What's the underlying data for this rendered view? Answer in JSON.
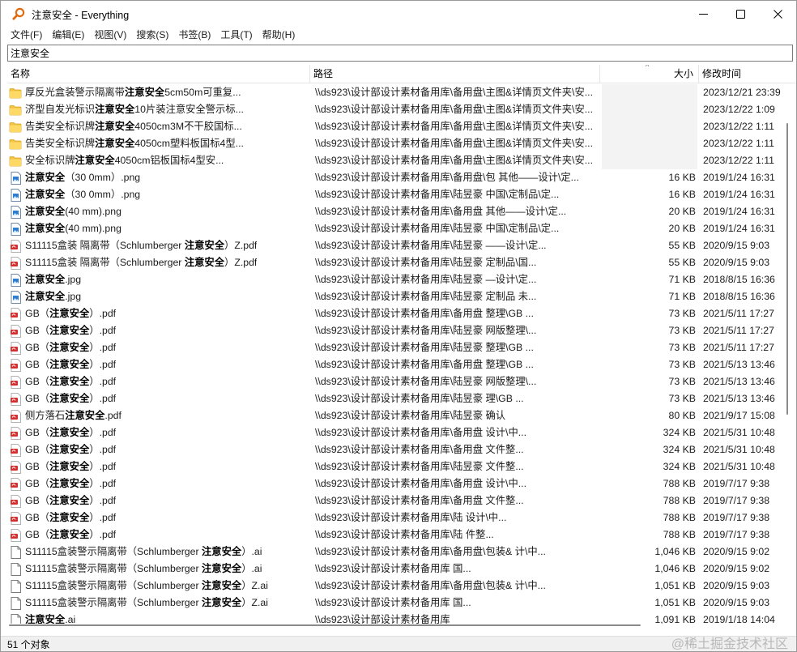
{
  "window": {
    "title": "注意安全 - Everything",
    "minimize_glyph": "—",
    "maximize_glyph": "☐",
    "close_glyph": "✕"
  },
  "menu": [
    "文件(F)",
    "编辑(E)",
    "视图(V)",
    "搜索(S)",
    "书签(B)",
    "工具(T)",
    "帮助(H)"
  ],
  "search": {
    "value": "注意安全"
  },
  "columns": {
    "name": "名称",
    "path": "路径",
    "size": "大小",
    "date": "修改时间",
    "sort_glyph": "^"
  },
  "rows": [
    {
      "icon": "folder",
      "pre": "厚反光盒装警示隔离带",
      "hl": "注意安全",
      "post": "5cm50m可重复...",
      "path": "\\\\ds923\\设计部设计素材备用库\\备用盘\\主图&详情页文件夹\\安...",
      "size": "",
      "date": "2023/12/21 23:39"
    },
    {
      "icon": "folder",
      "pre": "济型自发光标识",
      "hl": "注意安全",
      "post": "10片装注意安全警示标...",
      "path": "\\\\ds923\\设计部设计素材备用库\\备用盘\\主图&详情页文件夹\\安...",
      "size": "",
      "date": "2023/12/22 1:09"
    },
    {
      "icon": "folder",
      "pre": "告类安全标识牌",
      "hl": "注意安全",
      "post": "4050cm3M不干胶国标...",
      "path": "\\\\ds923\\设计部设计素材备用库\\备用盘\\主图&详情页文件夹\\安...",
      "size": "",
      "date": "2023/12/22 1:11"
    },
    {
      "icon": "folder",
      "pre": "告类安全标识牌",
      "hl": "注意安全",
      "post": "4050cm塑料板国标4型...",
      "path": "\\\\ds923\\设计部设计素材备用库\\备用盘\\主图&详情页文件夹\\安...",
      "size": "",
      "date": "2023/12/22 1:11"
    },
    {
      "icon": "folder",
      "pre": "安全标识牌",
      "hl": "注意安全",
      "post": "4050cm铝板国标4型安...",
      "path": "\\\\ds923\\设计部设计素材备用库\\备用盘\\主图&详情页文件夹\\安...",
      "size": "",
      "date": "2023/12/22 1:11"
    },
    {
      "icon": "image",
      "pre": "",
      "hl": "注意安全",
      "post": "（30 0mm）.png",
      "path": "\\\\ds923\\设计部设计素材备用库\\备用盘\\包 其他——设计\\定...",
      "size": "16 KB",
      "date": "2019/1/24 16:31"
    },
    {
      "icon": "image",
      "pre": "",
      "hl": "注意安全",
      "post": "（30 0mm）.png",
      "path": "\\\\ds923\\设计部设计素材备用库\\陆昱豪 中国\\定制品\\定...",
      "size": "16 KB",
      "date": "2019/1/24 16:31"
    },
    {
      "icon": "image",
      "pre": "",
      "hl": "注意安全",
      "post": "(40 mm).png",
      "path": "\\\\ds923\\设计部设计素材备用库\\备用盘 其他——设计\\定...",
      "size": "20 KB",
      "date": "2019/1/24 16:31"
    },
    {
      "icon": "image",
      "pre": "",
      "hl": "注意安全",
      "post": "(40 mm).png",
      "path": "\\\\ds923\\设计部设计素材备用库\\陆昱豪 中国\\定制品\\定...",
      "size": "20 KB",
      "date": "2019/1/24 16:31"
    },
    {
      "icon": "pdf",
      "pre": "S11115盒装 隔离带（Schlumberger ",
      "hl": "注意安全",
      "post": "）Z.pdf",
      "path": "\\\\ds923\\设计部设计素材备用库\\陆昱豪 ——设计\\定...",
      "size": "55 KB",
      "date": "2020/9/15 9:03"
    },
    {
      "icon": "pdf",
      "pre": "S11115盒装 隔离带（Schlumberger ",
      "hl": "注意安全",
      "post": "）Z.pdf",
      "path": "\\\\ds923\\设计部设计素材备用库\\陆昱豪 定制品\\国...",
      "size": "55 KB",
      "date": "2020/9/15 9:03"
    },
    {
      "icon": "image",
      "pre": "",
      "hl": "注意安全",
      "post": ".jpg",
      "path": "\\\\ds923\\设计部设计素材备用库\\陆昱豪 —设计\\定...",
      "size": "71 KB",
      "date": "2018/8/15 16:36"
    },
    {
      "icon": "image",
      "pre": "",
      "hl": "注意安全",
      "post": ".jpg",
      "path": "\\\\ds923\\设计部设计素材备用库\\陆昱豪 定制品 未...",
      "size": "71 KB",
      "date": "2018/8/15 16:36"
    },
    {
      "icon": "pdf",
      "pre": "GB（",
      "hl": "注意安全",
      "post": "）.pdf",
      "path": "\\\\ds923\\设计部设计素材备用库\\备用盘 整理\\GB ...",
      "size": "73 KB",
      "date": "2021/5/11 17:27"
    },
    {
      "icon": "pdf",
      "pre": "GB（",
      "hl": "注意安全",
      "post": "）.pdf",
      "path": "\\\\ds923\\设计部设计素材备用库\\陆昱豪 网版整理\\...",
      "size": "73 KB",
      "date": "2021/5/11 17:27"
    },
    {
      "icon": "pdf",
      "pre": "GB（",
      "hl": "注意安全",
      "post": "）.pdf",
      "path": "\\\\ds923\\设计部设计素材备用库\\陆昱豪 整理\\GB ...",
      "size": "73 KB",
      "date": "2021/5/11 17:27"
    },
    {
      "icon": "pdf",
      "pre": "GB（",
      "hl": "注意安全",
      "post": "）.pdf",
      "path": "\\\\ds923\\设计部设计素材备用库\\备用盘 整理\\GB ...",
      "size": "73 KB",
      "date": "2021/5/13 13:46"
    },
    {
      "icon": "pdf",
      "pre": "GB（",
      "hl": "注意安全",
      "post": "）.pdf",
      "path": "\\\\ds923\\设计部设计素材备用库\\陆昱豪 网版整理\\...",
      "size": "73 KB",
      "date": "2021/5/13 13:46"
    },
    {
      "icon": "pdf",
      "pre": "GB（",
      "hl": "注意安全",
      "post": "）.pdf",
      "path": "\\\\ds923\\设计部设计素材备用库\\陆昱豪 理\\GB ...",
      "size": "73 KB",
      "date": "2021/5/13 13:46"
    },
    {
      "icon": "pdf",
      "pre": "侧方落石",
      "hl": "注意安全",
      "post": ".pdf",
      "path": "\\\\ds923\\设计部设计素材备用库\\陆昱豪 确认",
      "size": "80 KB",
      "date": "2021/9/17 15:08"
    },
    {
      "icon": "pdf",
      "pre": "GB（",
      "hl": "注意安全",
      "post": "）.pdf",
      "path": "\\\\ds923\\设计部设计素材备用库\\备用盘 设计\\中...",
      "size": "324 KB",
      "date": "2021/5/31 10:48"
    },
    {
      "icon": "pdf",
      "pre": "GB（",
      "hl": "注意安全",
      "post": "）.pdf",
      "path": "\\\\ds923\\设计部设计素材备用库\\备用盘 文件整...",
      "size": "324 KB",
      "date": "2021/5/31 10:48"
    },
    {
      "icon": "pdf",
      "pre": "GB（",
      "hl": "注意安全",
      "post": "）.pdf",
      "path": "\\\\ds923\\设计部设计素材备用库\\陆昱豪 文件整...",
      "size": "324 KB",
      "date": "2021/5/31 10:48"
    },
    {
      "icon": "pdf",
      "pre": "GB（",
      "hl": "注意安全",
      "post": "）.pdf",
      "path": "\\\\ds923\\设计部设计素材备用库\\备用盘 设计\\中...",
      "size": "788 KB",
      "date": "2019/7/17 9:38"
    },
    {
      "icon": "pdf",
      "pre": "GB（",
      "hl": "注意安全",
      "post": "）.pdf",
      "path": "\\\\ds923\\设计部设计素材备用库\\备用盘 文件整...",
      "size": "788 KB",
      "date": "2019/7/17 9:38"
    },
    {
      "icon": "pdf",
      "pre": "GB（",
      "hl": "注意安全",
      "post": "）.pdf",
      "path": "\\\\ds923\\设计部设计素材备用库\\陆 设计\\中...",
      "size": "788 KB",
      "date": "2019/7/17 9:38"
    },
    {
      "icon": "pdf",
      "pre": "GB（",
      "hl": "注意安全",
      "post": "）.pdf",
      "path": "\\\\ds923\\设计部设计素材备用库\\陆 件整...",
      "size": "788 KB",
      "date": "2019/7/17 9:38"
    },
    {
      "icon": "file",
      "pre": "S11115盒装警示隔离带（Schlumberger ",
      "hl": "注意安全",
      "post": "）.ai",
      "path": "\\\\ds923\\设计部设计素材备用库\\备用盘\\包装& 计\\中...",
      "size": "1,046 KB",
      "date": "2020/9/15 9:02"
    },
    {
      "icon": "file",
      "pre": "S11115盒装警示隔离带（Schlumberger ",
      "hl": "注意安全",
      "post": "）.ai",
      "path": "\\\\ds923\\设计部设计素材备用库 国...",
      "size": "1,046 KB",
      "date": "2020/9/15 9:02"
    },
    {
      "icon": "file",
      "pre": "S11115盒装警示隔离带（Schlumberger ",
      "hl": "注意安全",
      "post": "）Z.ai",
      "path": "\\\\ds923\\设计部设计素材备用库\\备用盘\\包装& 计\\中...",
      "size": "1,051 KB",
      "date": "2020/9/15 9:03"
    },
    {
      "icon": "file",
      "pre": "S11115盒装警示隔离带（Schlumberger ",
      "hl": "注意安全",
      "post": "）Z.ai",
      "path": "\\\\ds923\\设计部设计素材备用库 国...",
      "size": "1,051 KB",
      "date": "2020/9/15 9:03"
    },
    {
      "icon": "file",
      "pre": "",
      "hl": "注意安全",
      "post": ".ai",
      "path": "\\\\ds923\\设计部设计素材备用库",
      "size": "1,091 KB",
      "date": "2019/1/18 14:04"
    }
  ],
  "status": {
    "count": "51 个对象"
  },
  "watermark": "@稀土掘金技术社区"
}
